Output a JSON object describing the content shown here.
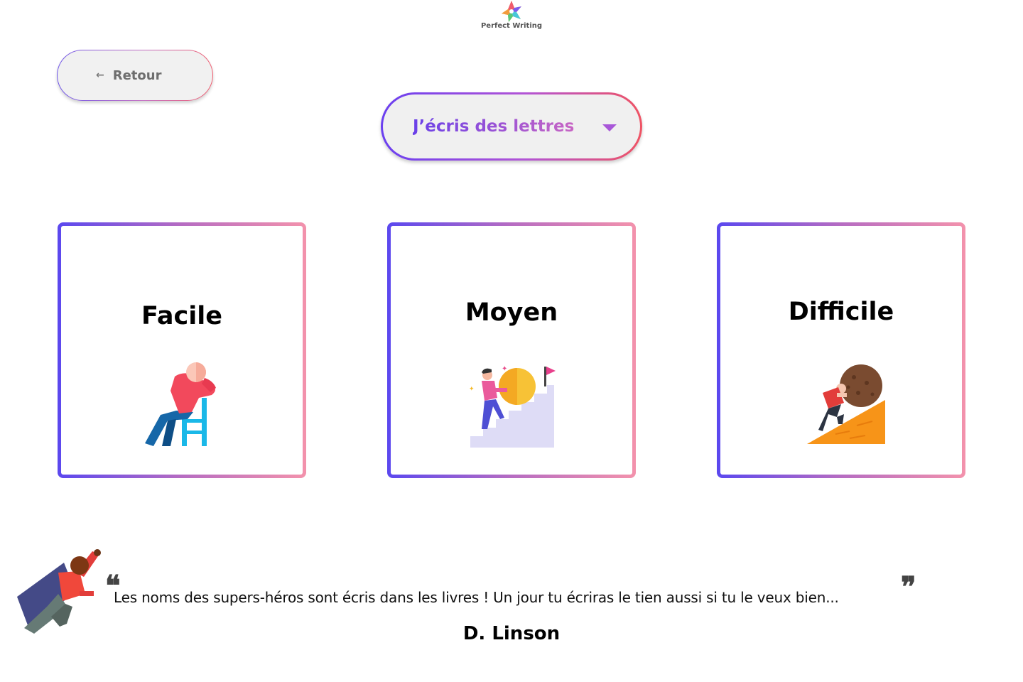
{
  "logo": {
    "text": "Perfect Writing",
    "icon": "star-logo-icon"
  },
  "back_button": {
    "label": "Retour",
    "icon": "arrow-left-icon"
  },
  "selector": {
    "label": "J’écris des lettres",
    "icon": "caret-down-icon"
  },
  "levels": [
    {
      "label": "Facile",
      "icon": "relaxed-chair-person-icon"
    },
    {
      "label": "Moyen",
      "icon": "climbing-stairs-person-icon"
    },
    {
      "label": "Difficile",
      "icon": "pushing-boulder-person-icon"
    }
  ],
  "quote": {
    "text": "Les noms des supers-héros sont écris dans les livres ! Un jour tu écriras le tien aussi si tu le veux bien...",
    "author": "D. Linson",
    "open_mark": "❝",
    "close_mark": "❞",
    "icon": "superhero-flying-icon"
  },
  "colors": {
    "gradient_start": "#5b48ef",
    "gradient_mid": "#b66cc2",
    "gradient_end": "#f392ac",
    "selector_accent": "#ef5363"
  }
}
